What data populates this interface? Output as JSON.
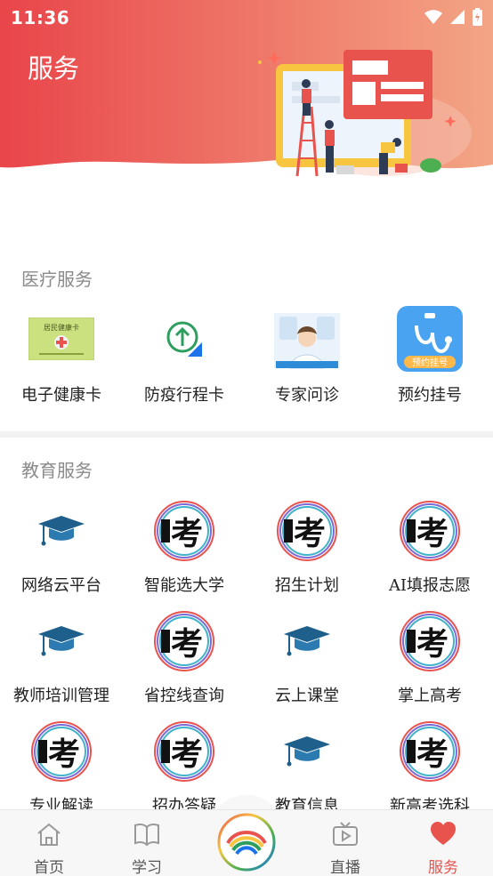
{
  "status_bar": {
    "time": "11:36"
  },
  "header": {
    "title": "服务"
  },
  "medical": {
    "title": "医疗服务",
    "items": [
      {
        "label": "电子健康卡",
        "icon": "health-card-icon"
      },
      {
        "label": "防疫行程卡",
        "icon": "trip-card-icon"
      },
      {
        "label": "专家问诊",
        "icon": "expert-consult-icon"
      },
      {
        "label": "预约挂号",
        "icon": "appointment-icon",
        "badge": "预约挂号"
      }
    ]
  },
  "education": {
    "title": "教育服务",
    "logo_text": "考",
    "items": [
      {
        "label": "网络云平台",
        "icon": "graduation-cap-icon"
      },
      {
        "label": "智能选大学",
        "icon": "exam-logo-icon"
      },
      {
        "label": "招生计划",
        "icon": "exam-logo-icon"
      },
      {
        "label": "AI填报志愿",
        "icon": "exam-logo-icon"
      },
      {
        "label": "教师培训管理",
        "icon": "graduation-cap-icon"
      },
      {
        "label": "省控线查询",
        "icon": "exam-logo-icon"
      },
      {
        "label": "云上课堂",
        "icon": "graduation-cap-icon"
      },
      {
        "label": "掌上高考",
        "icon": "exam-logo-icon"
      },
      {
        "label": "专业解读",
        "icon": "exam-logo-icon"
      },
      {
        "label": "招办答疑",
        "icon": "exam-logo-icon"
      },
      {
        "label": "教育信息",
        "icon": "graduation-cap-icon"
      },
      {
        "label": "新高考选科",
        "icon": "exam-logo-icon"
      }
    ]
  },
  "health_card": {
    "text": "居民健康卡"
  },
  "tabbar": {
    "items": [
      {
        "label": "首页",
        "icon": "home-icon"
      },
      {
        "label": "学习",
        "icon": "book-icon"
      },
      {
        "label": "直播",
        "icon": "tv-play-icon"
      },
      {
        "label": "服务",
        "icon": "heart-icon",
        "active": true
      }
    ]
  },
  "colors": {
    "accent": "#e8534e",
    "header_start": "#e9454a",
    "header_end": "#f3a585"
  }
}
